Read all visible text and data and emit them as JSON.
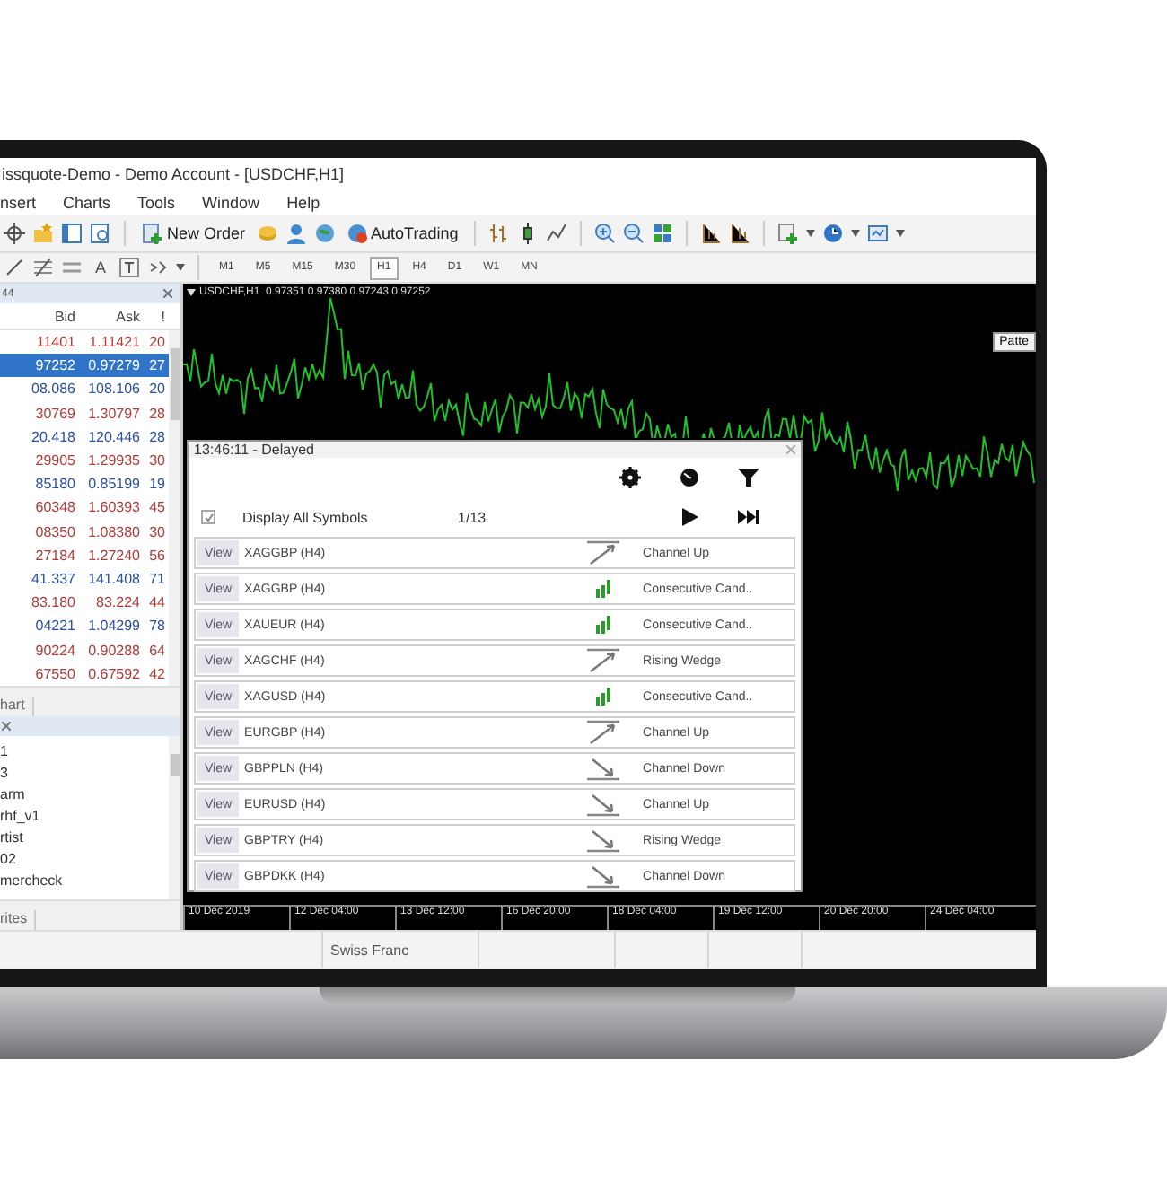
{
  "window": {
    "title": "issquote-Demo - Demo Account - [USDCHF,H1]"
  },
  "menu": [
    "nsert",
    "Charts",
    "Tools",
    "Window",
    "Help"
  ],
  "toolbar": {
    "new_order": "New Order",
    "autotrading": "AutoTrading"
  },
  "drawing_tools": {
    "text_tool": "A"
  },
  "timeframes": [
    {
      "label": "M1",
      "selected": false
    },
    {
      "label": "M5",
      "selected": false
    },
    {
      "label": "M15",
      "selected": false
    },
    {
      "label": "M30",
      "selected": false
    },
    {
      "label": "H1",
      "selected": true
    },
    {
      "label": "H4",
      "selected": false
    },
    {
      "label": "D1",
      "selected": false
    },
    {
      "label": "W1",
      "selected": false
    },
    {
      "label": "MN",
      "selected": false
    }
  ],
  "market_watch": {
    "header": "44",
    "columns": [
      "Bid",
      "Ask",
      "!"
    ],
    "rows": [
      {
        "bid": "11401",
        "ask": "1.11421",
        "spread": "20",
        "color": "#b03a3a",
        "selected": false
      },
      {
        "bid": "97252",
        "ask": "0.97279",
        "spread": "27",
        "selected": true
      },
      {
        "bid": "08.086",
        "ask": "108.106",
        "spread": "20",
        "color": "#2b4fa0",
        "selected": false
      },
      {
        "bid": "30769",
        "ask": "1.30797",
        "spread": "28",
        "color": "#b03a3a",
        "selected": false
      },
      {
        "bid": "20.418",
        "ask": "120.446",
        "spread": "28",
        "color": "#2b4fa0",
        "selected": false
      },
      {
        "bid": "29905",
        "ask": "1.29935",
        "spread": "30",
        "color": "#b03a3a",
        "selected": false
      },
      {
        "bid": "85180",
        "ask": "0.85199",
        "spread": "19",
        "color": "#2b4fa0",
        "selected": false
      },
      {
        "bid": "60348",
        "ask": "1.60393",
        "spread": "45",
        "color": "#b03a3a",
        "selected": false
      },
      {
        "bid": "08350",
        "ask": "1.08380",
        "spread": "30",
        "color": "#b03a3a",
        "selected": false
      },
      {
        "bid": "27184",
        "ask": "1.27240",
        "spread": "56",
        "color": "#b03a3a",
        "selected": false
      },
      {
        "bid": "41.337",
        "ask": "141.408",
        "spread": "71",
        "color": "#2b4fa0",
        "selected": false
      },
      {
        "bid": "83.180",
        "ask": "83.224",
        "spread": "44",
        "color": "#b03a3a",
        "selected": false
      },
      {
        "bid": "04221",
        "ask": "1.04299",
        "spread": "78",
        "color": "#2b4fa0",
        "selected": false
      },
      {
        "bid": "90224",
        "ask": "0.90288",
        "spread": "64",
        "color": "#b03a3a",
        "selected": false
      },
      {
        "bid": "67550",
        "ask": "0.67592",
        "spread": "42",
        "color": "#b03a3a",
        "selected": false
      }
    ],
    "tab": "hart"
  },
  "navigator": {
    "items": [
      "1",
      "3",
      "arm",
      "rhf_v1",
      "rtist",
      "02",
      "mercheck"
    ],
    "tab": "rites"
  },
  "chart": {
    "header": "USDCHF,H1  0.97351 0.97380 0.97243 0.97252",
    "pattern_button": "Patte",
    "dates": [
      "10 Dec 2019",
      "12 Dec 04:00",
      "13 Dec 12:00",
      "16 Dec 20:00",
      "18 Dec 04:00",
      "19 Dec 12:00",
      "20 Dec 20:00",
      "24 Dec 04:00"
    ]
  },
  "dialog": {
    "title": "13:46:11 - Delayed",
    "display_all": {
      "label": "Display All Symbols",
      "checked": true
    },
    "page": "1/13",
    "rows": [
      {
        "button": "View",
        "symbol": "XAGGBP (H4)",
        "kind": "rising",
        "pattern": "Channel Up"
      },
      {
        "button": "View",
        "symbol": "XAGGBP (H4)",
        "kind": "candles",
        "pattern": "Consecutive Cand.."
      },
      {
        "button": "View",
        "symbol": "XAUEUR (H4)",
        "kind": "candles",
        "pattern": "Consecutive Cand.."
      },
      {
        "button": "View",
        "symbol": "XAGCHF (H4)",
        "kind": "rising",
        "pattern": "Rising Wedge"
      },
      {
        "button": "View",
        "symbol": "XAGUSD (H4)",
        "kind": "candles",
        "pattern": "Consecutive Cand.."
      },
      {
        "button": "View",
        "symbol": "EURGBP (H4)",
        "kind": "rising",
        "pattern": "Channel Up"
      },
      {
        "button": "View",
        "symbol": "GBPPLN (H4)",
        "kind": "falling",
        "pattern": "Channel Down"
      },
      {
        "button": "View",
        "symbol": "EURUSD (H4)",
        "kind": "falling",
        "pattern": "Channel Up"
      },
      {
        "button": "View",
        "symbol": "GBPTRY (H4)",
        "kind": "falling",
        "pattern": "Rising Wedge"
      },
      {
        "button": "View",
        "symbol": "GBPDKK (H4)",
        "kind": "falling",
        "pattern": "Channel Down"
      }
    ]
  },
  "status_bar": {
    "text": "Swiss Franc"
  }
}
